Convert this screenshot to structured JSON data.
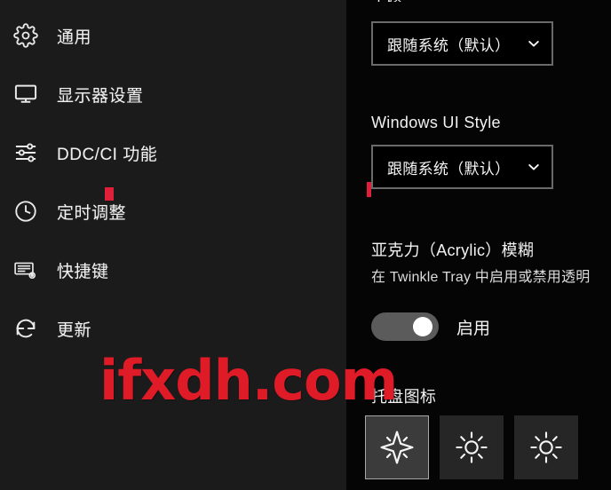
{
  "app": {
    "name": "Twinkle Tray",
    "accent_red": "#e01b28",
    "sidebar_bg": "#1b1b1b",
    "panel_bg": "#050505"
  },
  "sidebar": {
    "items": [
      {
        "label": "通用",
        "icon": "gear-icon"
      },
      {
        "label": "显示器设置",
        "icon": "monitor-icon"
      },
      {
        "label": "DDC/CI 功能",
        "icon": "sliders-icon"
      },
      {
        "label": "定时调整",
        "icon": "clock-icon"
      },
      {
        "label": "快捷键",
        "icon": "keyboard-icon"
      },
      {
        "label": "更新",
        "icon": "refresh-icon"
      }
    ]
  },
  "panel": {
    "theme": {
      "title": "主题",
      "selected": "跟随系统（默认）",
      "chevron": "chevron-down-icon"
    },
    "ui_style": {
      "title": "Windows UI Style",
      "selected": "跟随系统（默认）",
      "chevron": "chevron-down-icon"
    },
    "acrylic": {
      "title": "亚克力（Acrylic）模糊",
      "description": "在 Twinkle Tray 中启用或禁用透明",
      "toggle_state": "on",
      "toggle_label": "启用"
    },
    "tray": {
      "title": "托盘图标",
      "options": [
        {
          "icon": "sparkle-star-icon",
          "selected": true
        },
        {
          "icon": "brightness-sun-icon",
          "selected": false
        },
        {
          "icon": "brightness-sun-icon",
          "selected": false
        }
      ]
    }
  },
  "watermark": {
    "text": "ifxdh.com"
  }
}
